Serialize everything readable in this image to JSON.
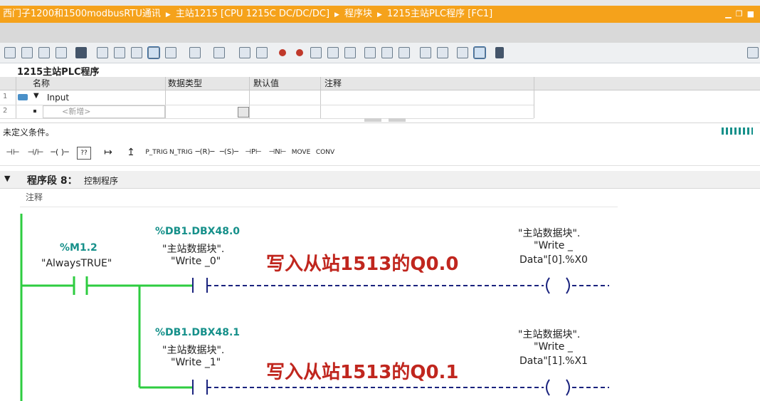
{
  "titlebar": {
    "crumbs": [
      "西门子1200和1500modbusRTU通讯",
      "主站1215 [CPU 1215C DC/DC/DC]",
      "程序块",
      "1215主站PLC程序 [FC1]"
    ]
  },
  "block": {
    "title": "1215主站PLC程序"
  },
  "interface": {
    "columns": [
      "名称",
      "数据类型",
      "默认值",
      "注释"
    ],
    "rows": [
      {
        "num": "1",
        "name": "Input"
      },
      {
        "num": "2",
        "name": "<新增>"
      }
    ]
  },
  "status": {
    "text": "未定义条件。"
  },
  "instructions": [
    "P_TRIG",
    "N_TRIG",
    "MOVE",
    "CONV"
  ],
  "network": {
    "title": "程序段 8：",
    "subtitle": "控制程序",
    "comment": "注释",
    "contact": {
      "address": "%M1.2",
      "symbol": "\"AlwaysTRUE\""
    },
    "rung1": {
      "address": "%DB1.DBX48.0",
      "symbol_line1": "\"主站数据块\".",
      "symbol_line2": "\"Write _0\"",
      "coil_line1": "\"主站数据块\".",
      "coil_line2": "\"Write _",
      "coil_line3": "Data\"[0].%X0",
      "overlay": "写入从站1513的Q0.0"
    },
    "rung2": {
      "address": "%DB1.DBX48.1",
      "symbol_line1": "\"主站数据块\".",
      "symbol_line2": "\"Write _1\"",
      "coil_line1": "\"主站数据块\".",
      "coil_line2": "\"Write _",
      "coil_line3": "Data\"[1].%X1",
      "overlay": "写入从站1513的Q0.1"
    }
  },
  "colors": {
    "titlebar": "#f5a21b",
    "rail": "#2ecc40",
    "address": "#16908a",
    "overlay": "#c0261e",
    "wire": "#1a237e"
  }
}
